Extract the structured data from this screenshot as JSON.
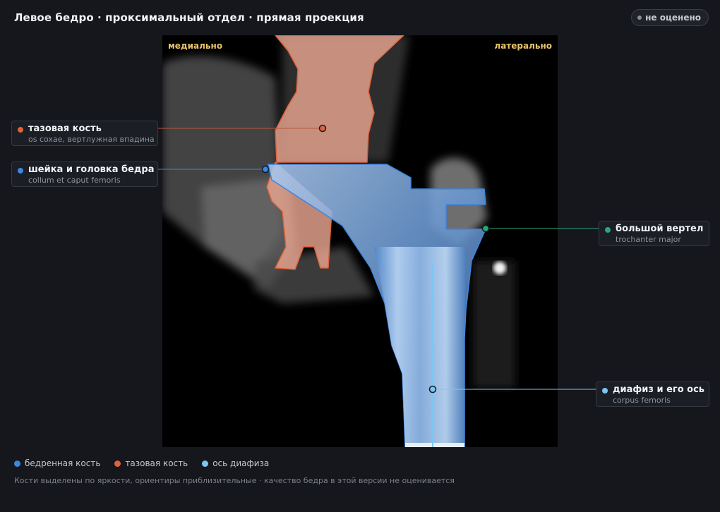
{
  "header": {
    "title": "Левое бедро · проксимальный отдел · прямая проекция",
    "status_badge": "не оценено"
  },
  "viewer": {
    "orient_left": "медиально",
    "orient_right": "латерально"
  },
  "callouts": {
    "pelvis": {
      "name": "тазовая кость",
      "latin": "os coxae, вертлужная впадина",
      "color": "#e0623a"
    },
    "neck": {
      "name": "шейка и головка бедра",
      "latin": "collum et caput femoris",
      "color": "#3e86e0"
    },
    "trochanter": {
      "name": "большой вертел",
      "latin": "trochanter major",
      "color": "#2aa77a"
    },
    "shaft": {
      "name": "диафиз и его ось",
      "latin": "corpus femoris",
      "color": "#7cc6f2"
    }
  },
  "legend": {
    "femur": {
      "label": "бедренная кость",
      "color": "#3e86e0"
    },
    "pelvis": {
      "label": "тазовая кость",
      "color": "#e0623a"
    },
    "axis": {
      "label": "ось диафиза",
      "color": "#7cc6f2"
    }
  },
  "footnote": "Кости выделены по яркости, ориентиры приблизительные · качество бедра в этой версии не оценивается"
}
